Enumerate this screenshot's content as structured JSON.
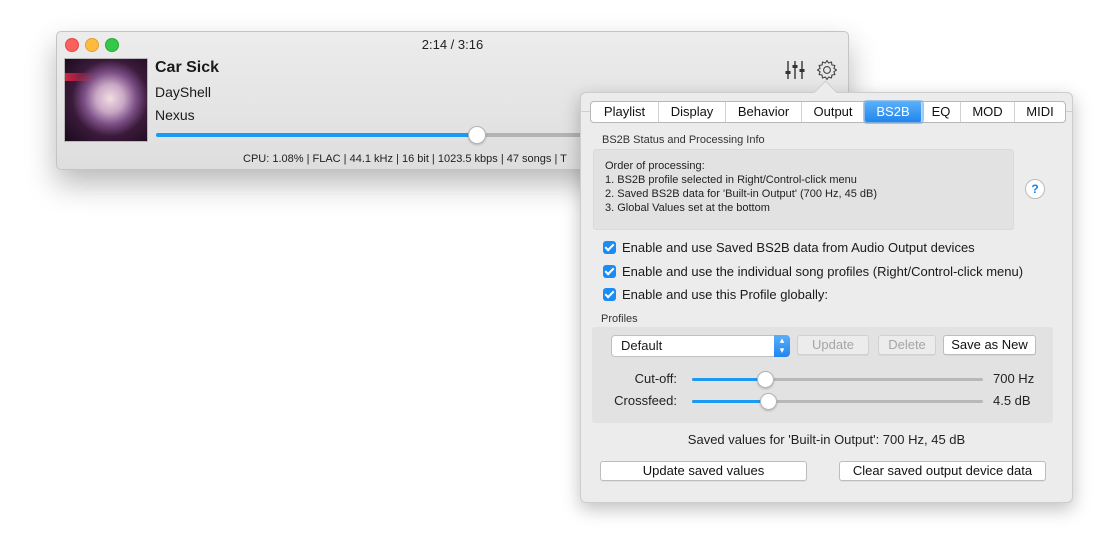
{
  "player": {
    "time": "2:14 / 3:16",
    "song_title": "Car Sick",
    "artist": "DayShell",
    "album": "Nexus",
    "progress_fraction": 0.47,
    "status_line": "CPU: 1.08% | FLAC | 44.1 kHz | 16 bit | 1023.5 kbps | 47 songs | T",
    "icons": {
      "equalizer": "sliders-icon",
      "settings": "gear-icon"
    },
    "accent_color": "#1a9af0"
  },
  "settings": {
    "tabs": [
      {
        "label": "Playlist",
        "active": false
      },
      {
        "label": "Display",
        "active": false
      },
      {
        "label": "Behavior",
        "active": false
      },
      {
        "label": "Output",
        "active": false
      },
      {
        "label": "BS2B",
        "active": true
      },
      {
        "label": "EQ",
        "active": false
      },
      {
        "label": "MOD",
        "active": false
      },
      {
        "label": "MIDI",
        "active": false
      }
    ],
    "info_section_label": "BS2B Status and Processing Info",
    "info_lines": [
      "Order of processing:",
      "1. BS2B profile selected in Right/Control-click menu",
      "2. Saved BS2B data for 'Built-in Output' (700 Hz, 45 dB)",
      "3. Global Values set at the bottom"
    ],
    "help_label": "?",
    "checkboxes": [
      {
        "label": "Enable and use Saved BS2B data from Audio Output devices",
        "checked": true
      },
      {
        "label": "Enable and use the individual song profiles (Right/Control-click menu)",
        "checked": true
      },
      {
        "label": "Enable and use this Profile globally:",
        "checked": true
      }
    ],
    "profiles_label": "Profiles",
    "profile_selected": "Default",
    "update_label": "Update",
    "delete_label": "Delete",
    "save_as_new_label": "Save as New",
    "cutoff_label": "Cut-off:",
    "cutoff_value": "700 Hz",
    "cutoff_fraction": 0.25,
    "crossfeed_label": "Crossfeed:",
    "crossfeed_value": "4.5 dB",
    "crossfeed_fraction": 0.26,
    "saved_values_text": "Saved values for 'Built-in Output': 700 Hz, 45 dB",
    "update_saved_label": "Update saved values",
    "clear_saved_label": "Clear saved output device data"
  }
}
